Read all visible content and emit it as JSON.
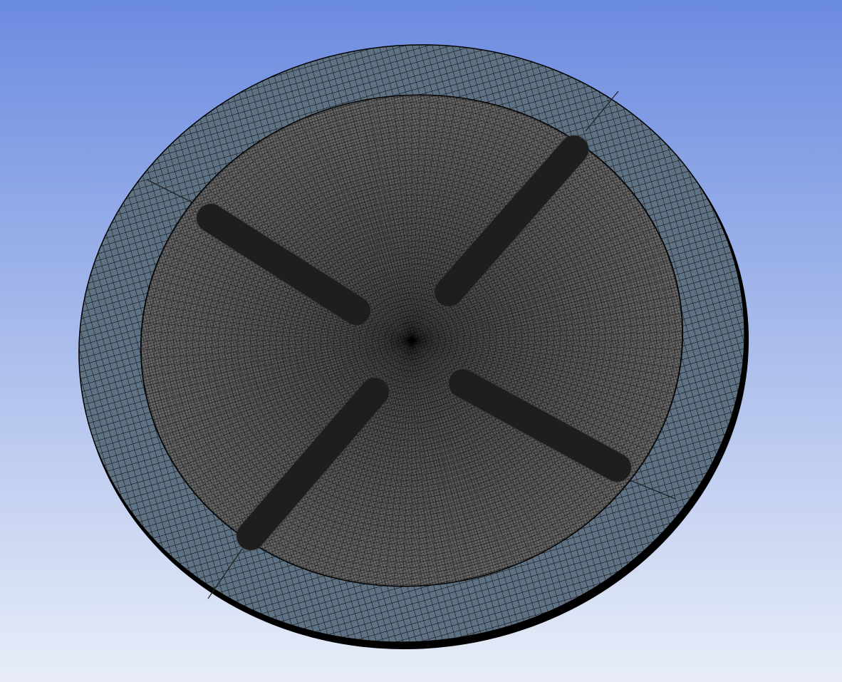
{
  "viewport": {
    "background_top_color": "#6b8be0",
    "background_bottom_color": "#e8edf8"
  },
  "model": {
    "outer_ring_face_color": "#5f7283",
    "inner_face_color": "#535353",
    "mesh_line_color": "#000000",
    "slot_fill_color": "#141414",
    "slot_count": 4
  }
}
